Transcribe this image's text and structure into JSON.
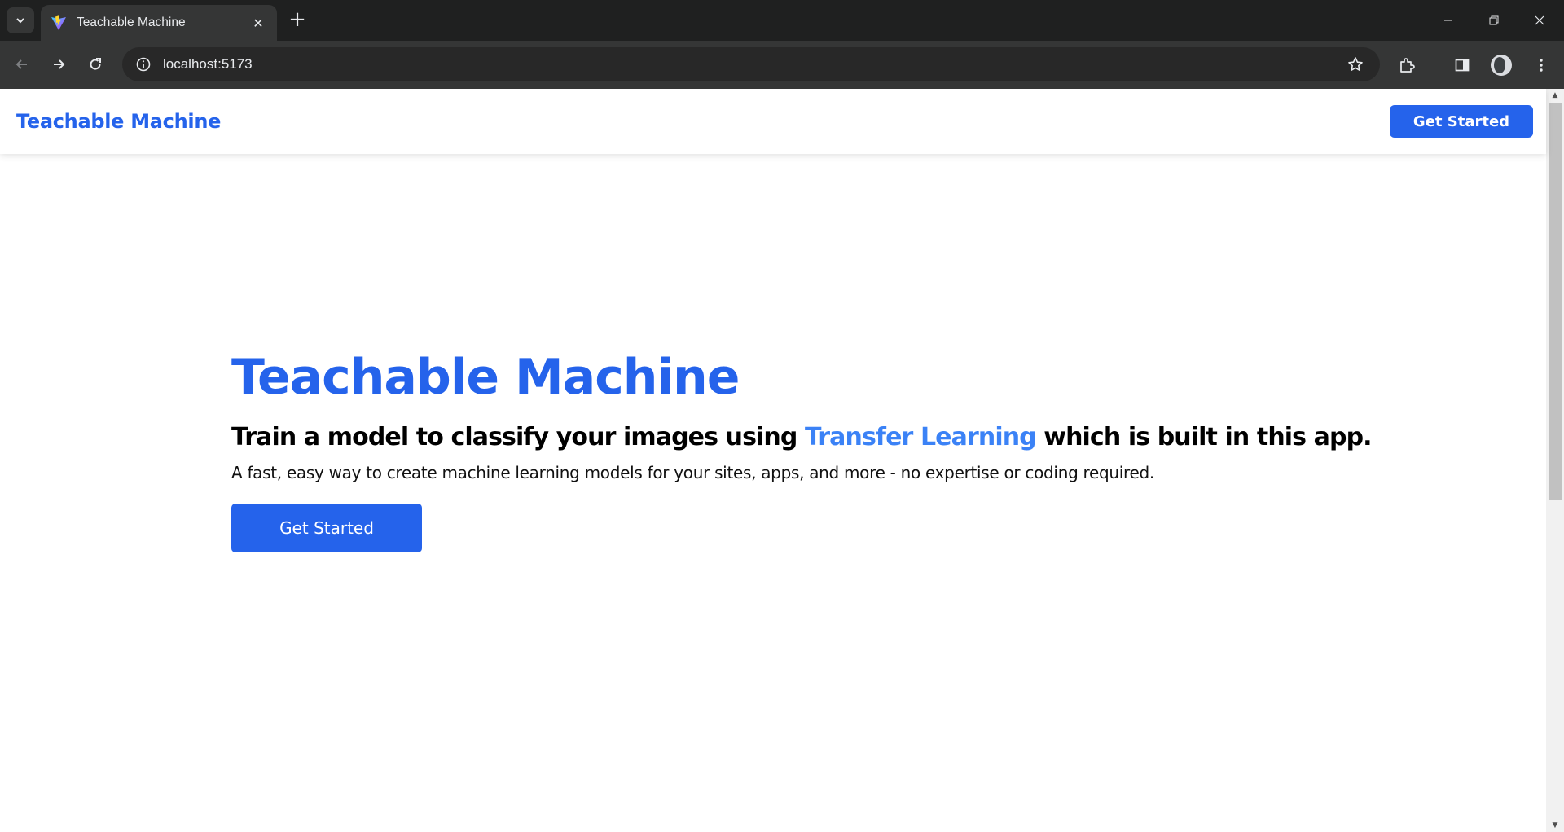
{
  "browser": {
    "tab": {
      "title": "Teachable Machine",
      "favicon": "vite-logo-icon"
    },
    "new_tab_glyph": "+",
    "close_glyph": "✕",
    "address": "localhost:5173",
    "icons": [
      "tab-search-icon",
      "back-icon",
      "forward-icon",
      "reload-icon",
      "site-info-icon",
      "bookmark-star-icon",
      "extensions-icon",
      "side-panel-icon",
      "profile-avatar",
      "more-menu-icon",
      "minimize-icon",
      "restore-icon",
      "close-window-icon"
    ]
  },
  "navbar": {
    "brand": "Teachable Machine",
    "cta_label": "Get Started"
  },
  "hero": {
    "title": "Teachable Machine",
    "subtitle_before": "Train a model to classify your images using ",
    "subtitle_highlight": "Transfer Learning",
    "subtitle_after": " which is built in this app.",
    "description": "A fast, easy way to create machine learning models for your sites, apps, and more - no expertise or coding required.",
    "cta_label": "Get Started"
  },
  "colors": {
    "primary": "#2563eb",
    "highlight": "#3b82f6",
    "chrome_dark": "#1f2020",
    "chrome_toolbar": "#353636"
  }
}
